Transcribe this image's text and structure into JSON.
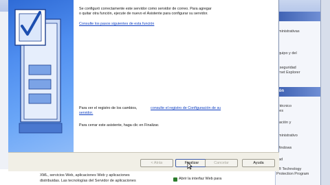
{
  "wizard": {
    "intro_line1": "Se configuró correctamente este servidor como servidor de correo. Para agregar",
    "intro_line2": "o quitar otra función, ejecute de nuevo el Asistente para configurar su servidor.",
    "next_steps_link": "Consulte los pasos siguientes de esta función",
    "log_text": "Para ver el registro de los cambios,",
    "log_link": "consulte el registro de Configuración de su",
    "log_link2": "servidor.",
    "close_text": "Para cerrar este asistente, haga clic en Finalizar.",
    "buttons": {
      "back": "< Atrás",
      "finish": "Finalizar",
      "cancel": "Cancelar",
      "help": "Ayuda"
    }
  },
  "background": {
    "right_items": [
      "dministrativas",
      "s",
      "equipo y del",
      "el",
      "e seguridad",
      "ernet Explorer"
    ],
    "right_section_head": "ión",
    "right_items2": [
      "e técnico",
      "ales",
      "ización y",
      "dministrativo",
      "Windows",
      "dad",
      "ft® Technology",
      "Protection Program"
    ],
    "bottom_line1": "XML, servicios Web, aplicaciones Web y aplicaciones",
    "bottom_line2": "distribuidas. Las tecnologías del Servidor de aplicaciones",
    "web_link": "Abrir la interfaz Web para"
  },
  "colors": {
    "banner_start": "#2f6bd6",
    "banner_end": "#8dbaf8",
    "link": "#0b3cc1",
    "checkmark": "#1d4fb0"
  }
}
